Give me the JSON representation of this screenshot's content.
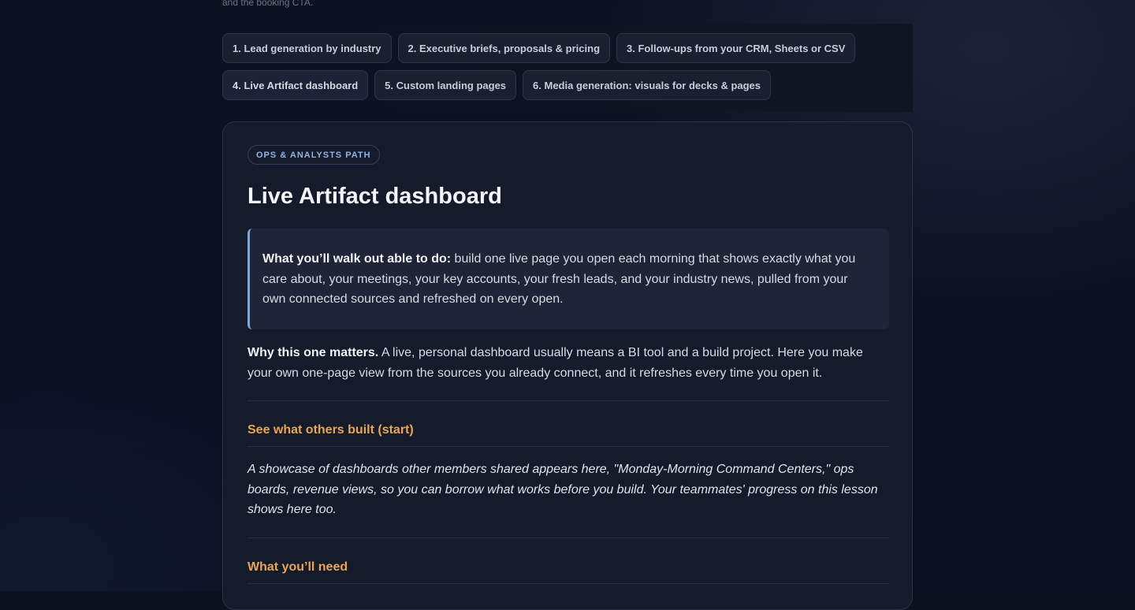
{
  "top_fade_text": "and the booking CTA.",
  "tabs": [
    {
      "label": "1. Lead generation by industry"
    },
    {
      "label": "2. Executive briefs, proposals & pricing"
    },
    {
      "label": "3. Follow-ups from your CRM, Sheets or CSV"
    },
    {
      "label": "4. Live Artifact dashboard"
    },
    {
      "label": "5. Custom landing pages"
    },
    {
      "label": "6. Media generation: visuals for decks & pages"
    }
  ],
  "lesson": {
    "badge": "OPS & ANALYSTS PATH",
    "title": "Live Artifact dashboard",
    "callout_lead": "What you’ll walk out able to do:",
    "callout_body": " build one live page you open each morning that shows exactly what you care about, your meetings, your key accounts, your fresh leads, and your industry news, pulled from your own connected sources and refreshed on every open.",
    "why_lead": "Why this one matters.",
    "why_body": " A live, personal dashboard usually means a BI tool and a build project. Here you make your own one-page view from the sources you already connect, and it refreshes every time you open it.",
    "section_showcase": "See what others built (start)",
    "showcase_text": "A showcase of dashboards other members shared appears here, \"Monday-Morning Command Centers,\" ops boards, revenue views, so you can borrow what works before you build. Your teammates' progress on this lesson shows here too.",
    "section_need": "What you’ll need"
  },
  "colors": {
    "accent_blue": "#7aa7dc",
    "section_orange": "#e9a556",
    "card_bg": "#161b2b"
  }
}
